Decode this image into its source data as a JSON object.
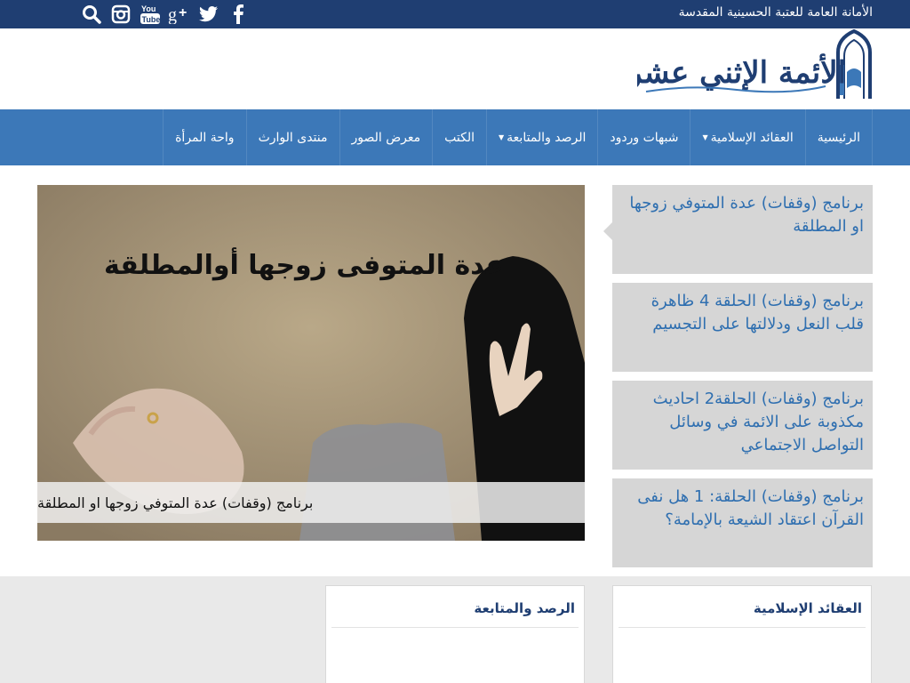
{
  "topbar": {
    "site_label": "الأمانة العامة للعتبة الحسينية المقدسة",
    "icons": [
      "search-icon",
      "instagram-icon",
      "youtube-icon",
      "google-plus-icon",
      "twitter-icon",
      "facebook-icon"
    ]
  },
  "logo": {
    "text": "الأئمة الإثني عشر"
  },
  "nav": {
    "items": [
      {
        "label": "الرئيسية",
        "has_dropdown": false
      },
      {
        "label": "العقائد الإسلامية",
        "has_dropdown": true
      },
      {
        "label": "شبهات وردود",
        "has_dropdown": false
      },
      {
        "label": "الرصد والمتابعة",
        "has_dropdown": true
      },
      {
        "label": "الكتب",
        "has_dropdown": false
      },
      {
        "label": "معرض الصور",
        "has_dropdown": false
      },
      {
        "label": "منتدى الوارث",
        "has_dropdown": false
      },
      {
        "label": "واحة المرأة",
        "has_dropdown": false
      }
    ]
  },
  "featured": {
    "image_text": "عدة المتوفى زوجها أوالمطلقة",
    "caption": "برنامج (وقفات) عدة المتوفي زوجها او المطلقة"
  },
  "side_list": [
    {
      "title": "برنامج (وقفات) عدة المتوفي زوجها او المطلقة"
    },
    {
      "title": "برنامج (وقفات) الحلقة 4 ظاهرة قلب النعل ودلالتها على التجسيم"
    },
    {
      "title": "برنامج (وقفات) الحلقة2 احاديث مكذوبة على الائمة في وسائل التواصل الاجتماعي"
    },
    {
      "title": "برنامج (وقفات) الحلقة: 1 هل نفى القرآن اعتقاد الشيعة بالإمامة؟"
    }
  ],
  "sections": [
    {
      "title": "العقائد الإسلامية"
    },
    {
      "title": "الرصد والمتابعة"
    }
  ],
  "colors": {
    "topbar": "#1f3e72",
    "nav": "#3c78b8",
    "link": "#2f6fb0",
    "side_bg": "#d6d6d6"
  }
}
